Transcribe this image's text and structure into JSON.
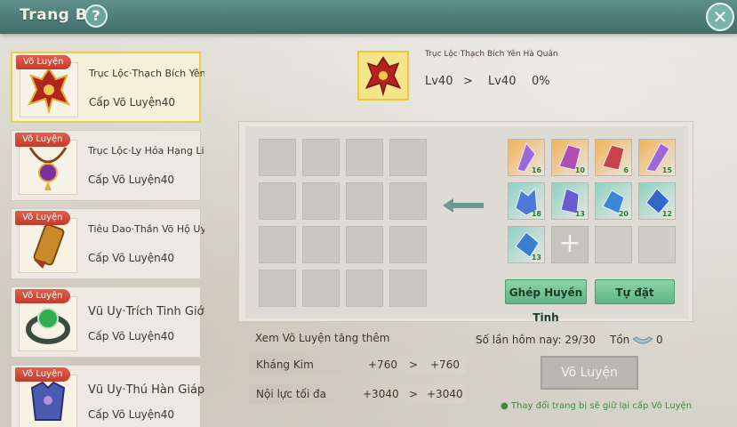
{
  "header": {
    "title": "Trang Bị",
    "help": "?",
    "close": "✕"
  },
  "items": [
    {
      "tag": "Võ Luyện",
      "name": "Trục Lộc·Thạch Bích Yên Hà Quân",
      "level": "Cấp Võ Luyện40",
      "icon": "crimson-armor-icon"
    },
    {
      "tag": "Võ Luyện",
      "name": "Trục Lộc·Ly Hỏa Hạng Liên",
      "level": "Cấp Võ Luyện40",
      "icon": "necklace-icon"
    },
    {
      "tag": "Võ Luyện",
      "name": "Tiêu Dao·Thần Võ Hộ Uyển",
      "level": "Cấp Võ Luyện40",
      "icon": "bracer-icon"
    },
    {
      "tag": "Võ Luyện",
      "name": "Vũ Uy·Trích Tinh Giới",
      "level": "Cấp Võ Luyện40",
      "icon": "ring-icon"
    },
    {
      "tag": "Võ Luyện",
      "name": "Vũ Uy·Thú Hàn Giáp",
      "level": "Cấp Võ Luyện40",
      "icon": "armor-icon"
    }
  ],
  "selected": {
    "name": "Trục Lộc·Thạch Bích Yên Hà Quân",
    "lv_from": "Lv40",
    "arrow": ">",
    "lv_to": "Lv40",
    "percent": "0%"
  },
  "materials": [
    {
      "count": "16",
      "color": "#9b6ad8"
    },
    {
      "count": "10",
      "color": "#b14fb0"
    },
    {
      "count": "6",
      "color": "#c9434a"
    },
    {
      "count": "15",
      "color": "#9d66d9"
    },
    {
      "count": "18",
      "color": "#4f78d6"
    },
    {
      "count": "13",
      "color": "#6a5bd0"
    },
    {
      "count": "20",
      "color": "#3b86d8"
    },
    {
      "count": "12",
      "color": "#3167c9"
    },
    {
      "count": "13",
      "color": "#3c7dcc"
    }
  ],
  "buttons": {
    "compose": "Ghép Huyền Tinh",
    "auto": "Tự đặt",
    "train": "Võ Luyện"
  },
  "stats": {
    "title": "Xem Võ Luyện tăng thêm",
    "rows": [
      {
        "label": "Kháng Kim",
        "from": "+760",
        "arrow": ">",
        "to": "+760"
      },
      {
        "label": "Nội lực tối đa",
        "from": "+3040",
        "arrow": ">",
        "to": "+3040"
      }
    ]
  },
  "daily": "Số lần hôm nay: 29/30",
  "stock": {
    "label": "Tồn",
    "value": "0"
  },
  "note": "Thay đổi trang bị sẽ giữ lại cấp Võ Luyện"
}
